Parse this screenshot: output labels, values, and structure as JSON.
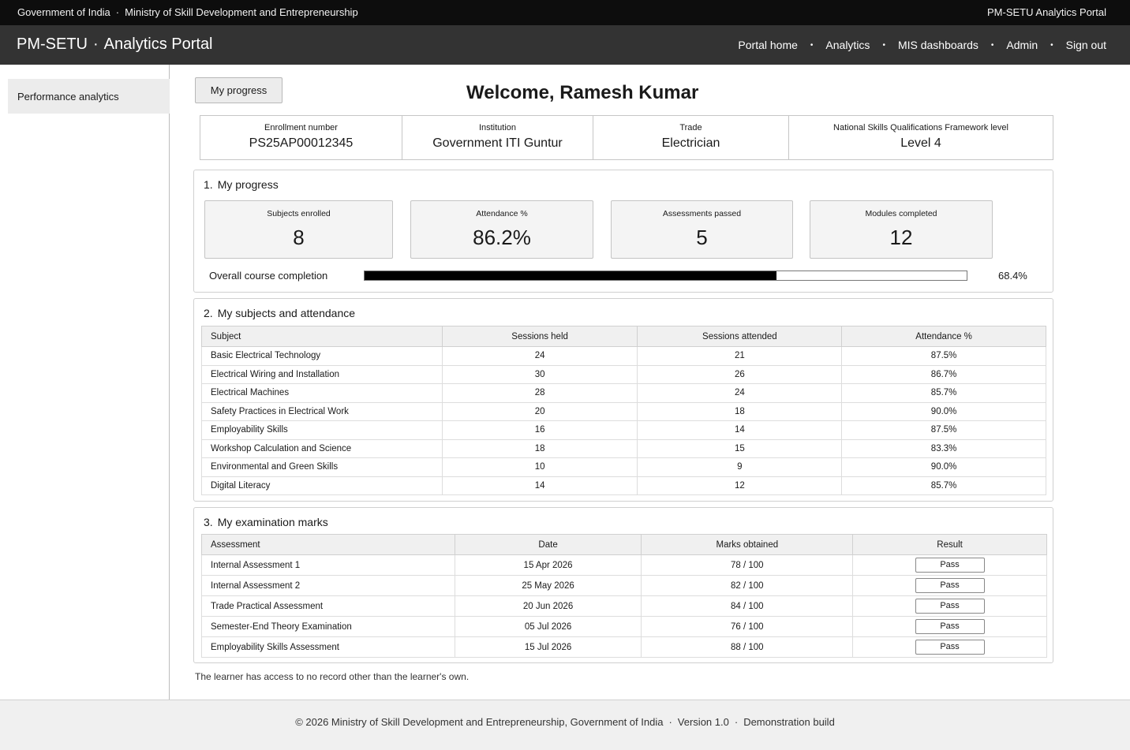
{
  "gov_bar": {
    "left_primary": "Government of India",
    "separator": "·",
    "left_secondary": "Ministry of Skill Development and Entrepreneurship",
    "right_title": "PM-SETU Analytics Portal"
  },
  "nav": {
    "brand_primary": "PM-SETU",
    "brand_separator": "·",
    "brand_secondary": "Analytics Portal",
    "separator": "•",
    "links": [
      "Portal home",
      "Analytics",
      "MIS dashboards",
      "Admin",
      "Sign out"
    ]
  },
  "sidebar": {
    "items": [
      {
        "label": "Performance analytics"
      }
    ]
  },
  "header": {
    "my_progress_button": "My progress",
    "welcome": "Welcome, Ramesh Kumar"
  },
  "info": [
    {
      "label": "Enrollment number",
      "value": "PS25AP00012345"
    },
    {
      "label": "Institution",
      "value": "Government ITI Guntur"
    },
    {
      "label": "Trade",
      "value": "Electrician"
    },
    {
      "label": "National Skills Qualifications Framework level",
      "value": "Level 4"
    }
  ],
  "progress": {
    "number": "1.",
    "title": "My progress",
    "stats": [
      {
        "label": "Subjects enrolled",
        "value": "8"
      },
      {
        "label": "Attendance %",
        "value": "86.2%"
      },
      {
        "label": "Assessments passed",
        "value": "5"
      },
      {
        "label": "Modules completed",
        "value": "12"
      }
    ],
    "completion_label": "Overall course completion",
    "completion_fraction": 0.684,
    "completion_text": "68.4%"
  },
  "subjects": {
    "number": "2.",
    "title": "My subjects and attendance",
    "headers": [
      "Subject",
      "Sessions held",
      "Sessions attended",
      "Attendance %"
    ],
    "rows": [
      [
        "Basic Electrical Technology",
        "24",
        "21",
        "87.5%"
      ],
      [
        "Electrical Wiring and Installation",
        "30",
        "26",
        "86.7%"
      ],
      [
        "Electrical Machines",
        "28",
        "24",
        "85.7%"
      ],
      [
        "Safety Practices in Electrical Work",
        "20",
        "18",
        "90.0%"
      ],
      [
        "Employability Skills",
        "16",
        "14",
        "87.5%"
      ],
      [
        "Workshop Calculation and Science",
        "18",
        "15",
        "83.3%"
      ],
      [
        "Environmental and Green Skills",
        "10",
        "9",
        "90.0%"
      ],
      [
        "Digital Literacy",
        "14",
        "12",
        "85.7%"
      ]
    ]
  },
  "exams": {
    "number": "3.",
    "title": "My examination marks",
    "headers": [
      "Assessment",
      "Date",
      "Marks obtained",
      "Result"
    ],
    "rows": [
      [
        "Internal Assessment 1",
        "15 Apr 2026",
        "78 / 100",
        "Pass"
      ],
      [
        "Internal Assessment 2",
        "25 May 2026",
        "82 / 100",
        "Pass"
      ],
      [
        "Trade Practical Assessment",
        "20 Jun 2026",
        "84 / 100",
        "Pass"
      ],
      [
        "Semester-End Theory Examination",
        "05 Jul 2026",
        "76 / 100",
        "Pass"
      ],
      [
        "Employability Skills Assessment",
        "15 Jul 2026",
        "88 / 100",
        "Pass"
      ]
    ]
  },
  "disclaimer": "The learner has access to no record other than the learner's own.",
  "footer": {
    "copyright": "© 2026 Ministry of Skill Development and Entrepreneurship, Government of India",
    "separator": "·",
    "version": "Version 1.0",
    "build": "Demonstration build"
  }
}
